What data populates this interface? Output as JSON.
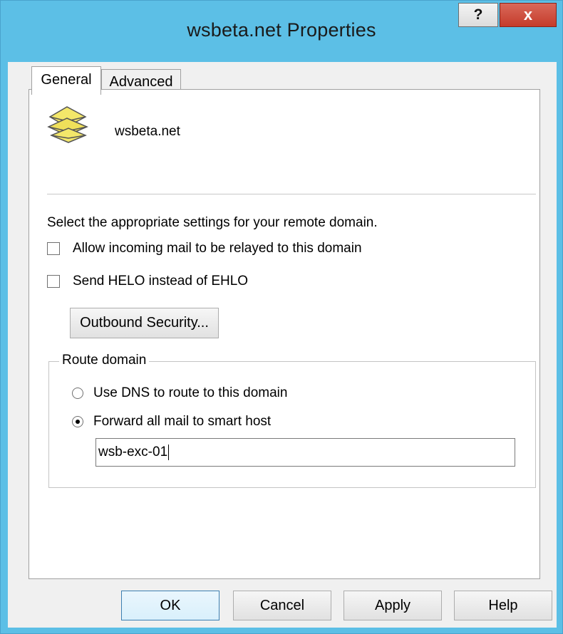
{
  "window": {
    "title": "wsbeta.net Properties",
    "help_glyph": "?",
    "close_glyph": "x",
    "accent_color": "#5cbfe6"
  },
  "tabs": [
    {
      "label": "General",
      "selected": true
    },
    {
      "label": "Advanced",
      "selected": false
    }
  ],
  "general": {
    "icon": "envelopes-icon",
    "domain_name": "wsbeta.net",
    "instructions": "Select the appropriate settings for your remote domain.",
    "relay_checkbox": {
      "label": "Allow incoming mail to be relayed to this domain",
      "checked": false
    },
    "helo_checkbox": {
      "label": "Send HELO instead of EHLO",
      "checked": false
    },
    "outbound_security_label": "Outbound Security...",
    "route_group": {
      "label": "Route domain",
      "use_dns": {
        "label": "Use DNS to route to this domain",
        "selected": false
      },
      "forward_smart_host": {
        "label": "Forward all mail to smart host",
        "selected": true
      },
      "smart_host_value": "wsb-exc-01"
    }
  },
  "footer": {
    "ok_label": "OK",
    "cancel_label": "Cancel",
    "apply_label": "Apply",
    "help_label": "Help"
  }
}
